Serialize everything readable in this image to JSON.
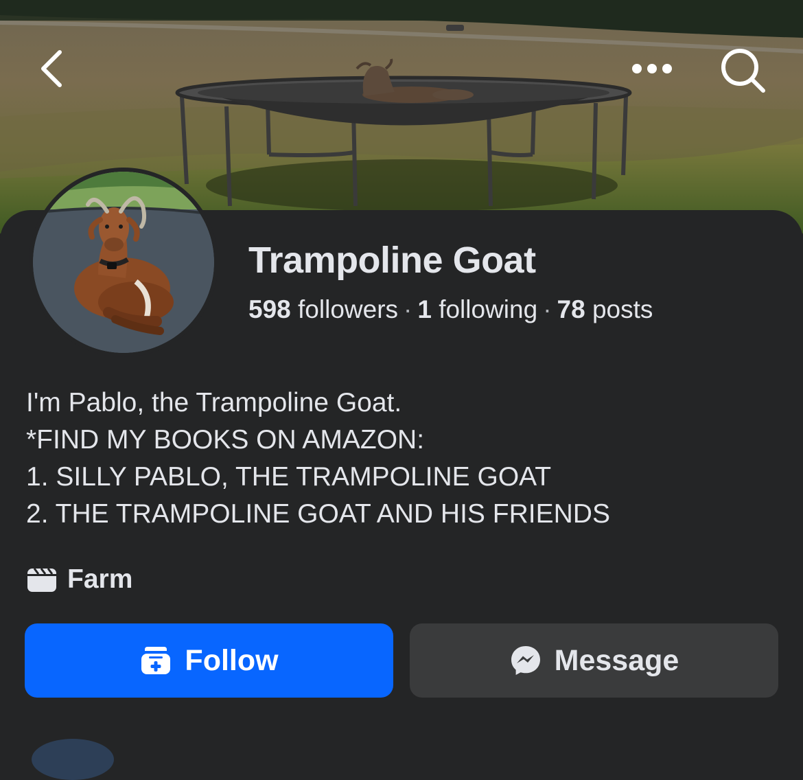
{
  "header": {
    "back_icon": "chevron-left-icon",
    "more_icon": "ellipsis-icon",
    "search_icon": "search-icon"
  },
  "profile": {
    "name": "Trampoline Goat",
    "stats": {
      "followers_count": "598",
      "followers_label": "followers",
      "following_count": "1",
      "following_label": "following",
      "posts_count": "78",
      "posts_label": "posts",
      "separator": "·"
    },
    "bio": [
      "I'm Pablo, the Trampoline Goat.",
      "*FIND MY BOOKS ON AMAZON:",
      "1. SILLY PABLO, THE TRAMPOLINE GOAT",
      "2. THE TRAMPOLINE GOAT AND HIS FRIENDS"
    ],
    "category": {
      "icon": "clapperboard-icon",
      "label": "Farm"
    }
  },
  "actions": {
    "follow_label": "Follow",
    "follow_icon": "follow-page-icon",
    "message_label": "Message",
    "message_icon": "messenger-icon"
  },
  "colors": {
    "background": "#242526",
    "primary_button": "#0866ff",
    "secondary_button": "#3a3b3c",
    "text": "#e4e6eb"
  }
}
